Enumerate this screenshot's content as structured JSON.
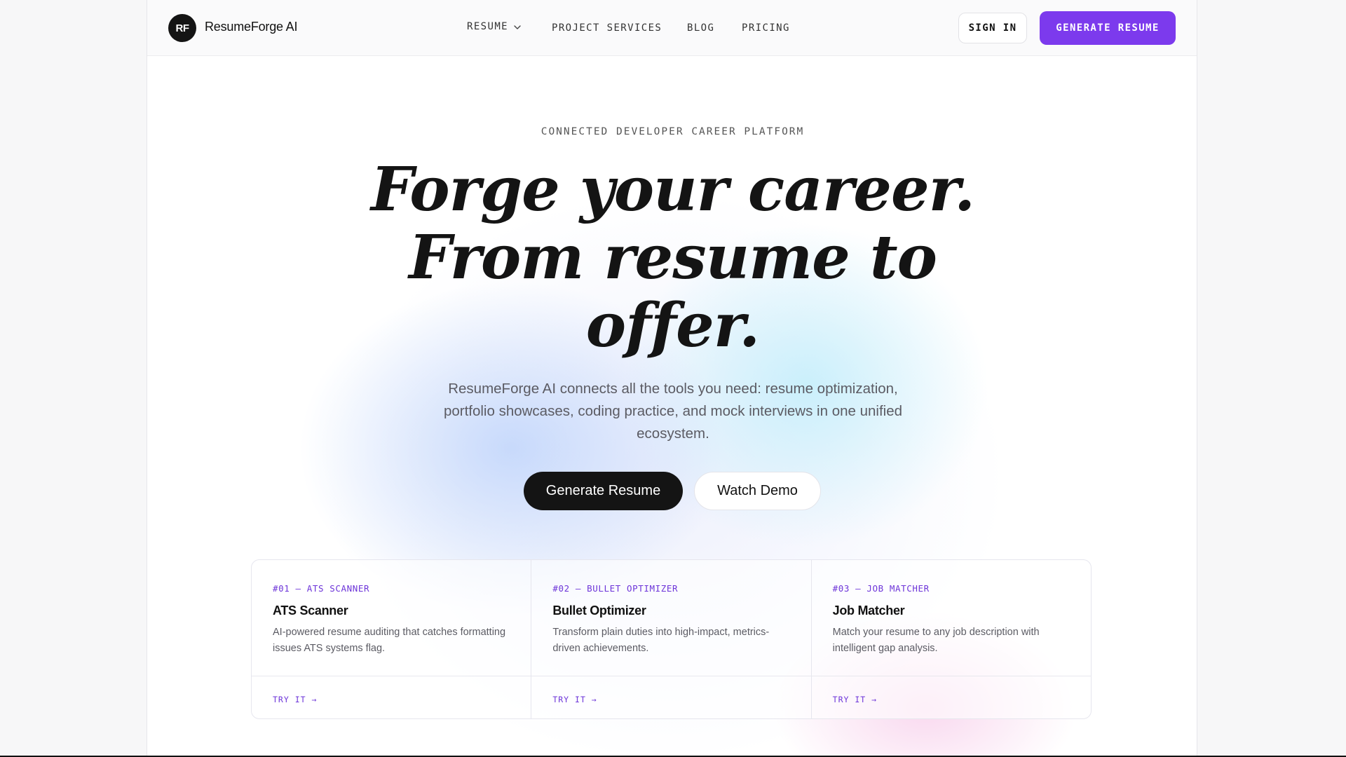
{
  "header": {
    "logo_initials": "RF",
    "brand_name": "ResumeForge AI",
    "nav": [
      {
        "label": "RESUME",
        "has_dropdown": true,
        "icon": "chevron-down-icon"
      },
      {
        "label": "PROJECT SERVICES"
      },
      {
        "label": "BLOG"
      },
      {
        "label": "PRICING"
      }
    ],
    "sign_in_label": "SIGN IN",
    "generate_label": "GENERATE RESUME"
  },
  "hero": {
    "eyebrow": "CONNECTED DEVELOPER CAREER PLATFORM",
    "headline_lines": [
      "Forge your career.",
      "From resume to",
      "offer."
    ],
    "subhead": "ResumeForge AI connects all the tools you need: resume optimization, portfolio showcases, coding practice, and mock interviews in one unified ecosystem.",
    "primary_cta": "Generate Resume",
    "secondary_cta": "Watch Demo"
  },
  "features": [
    {
      "tag": "#01 — ATS SCANNER",
      "title": "ATS Scanner",
      "description": "AI-powered resume auditing that catches formatting issues ATS systems flag.",
      "link": "TRY IT →"
    },
    {
      "tag": "#02 — BULLET OPTIMIZER",
      "title": "Bullet Optimizer",
      "description": "Transform plain duties into high-impact, metrics-driven achievements.",
      "link": "TRY IT →"
    },
    {
      "tag": "#03 — JOB MATCHER",
      "title": "Job Matcher",
      "description": "Match your resume to any job description with intelligent gap analysis.",
      "link": "TRY IT →"
    }
  ],
  "colors": {
    "accent": "#7c3aed",
    "dark": "#141414",
    "text_muted": "#5b5b63"
  }
}
